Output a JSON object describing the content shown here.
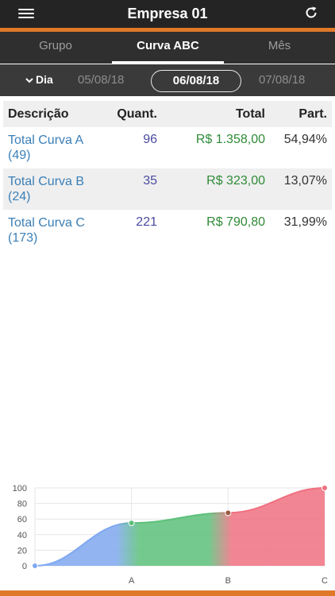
{
  "header": {
    "title": "Empresa 01",
    "menu_icon": "menu-icon",
    "refresh_icon": "refresh-icon"
  },
  "tabs": [
    {
      "label": "Grupo",
      "active": false
    },
    {
      "label": "Curva ABC",
      "active": true
    },
    {
      "label": "Mês",
      "active": false
    }
  ],
  "datebar": {
    "period_label": "Dia",
    "prev_date": "05/08/18",
    "current_date": "06/08/18",
    "next_date": "07/08/18"
  },
  "table": {
    "headers": {
      "descricao": "Descrição",
      "quant": "Quant.",
      "total": "Total",
      "part": "Part."
    },
    "rows": [
      {
        "descricao": "Total Curva A (49)",
        "quant": "96",
        "total": "R$ 1.358,00",
        "part": "54,94%"
      },
      {
        "descricao": "Total Curva B (24)",
        "quant": "35",
        "total": "R$ 323,00",
        "part": "13,07%"
      },
      {
        "descricao": "Total Curva C (173)",
        "quant": "221",
        "total": "R$ 790,80",
        "part": "31,99%"
      }
    ]
  },
  "chart_data": {
    "type": "area",
    "categories": [
      "",
      "A",
      "B",
      "C"
    ],
    "values": [
      0,
      55,
      68,
      100
    ],
    "ylim": [
      0,
      100
    ],
    "yticks": [
      "0",
      "20",
      "40",
      "60",
      "80",
      "100"
    ],
    "colors": {
      "A": "#7fa8f0",
      "B": "#5cc07a",
      "C": "#f07080"
    },
    "grid": true
  },
  "colors": {
    "accent": "#e0782a",
    "header_bg": "#242424"
  }
}
